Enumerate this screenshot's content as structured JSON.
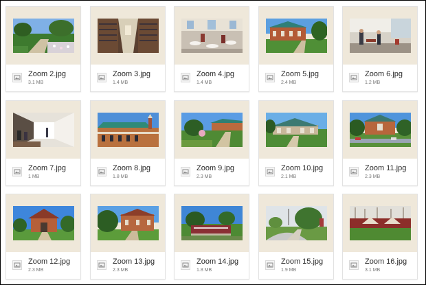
{
  "files": [
    {
      "name": "Zoom 2.jpg",
      "size": "3.1 MB",
      "icon": "image-file-icon"
    },
    {
      "name": "Zoom 3.jpg",
      "size": "1.4 MB",
      "icon": "image-file-icon"
    },
    {
      "name": "Zoom 4.jpg",
      "size": "1.4 MB",
      "icon": "image-file-icon"
    },
    {
      "name": "Zoom 5.jpg",
      "size": "2.4 MB",
      "icon": "image-file-icon"
    },
    {
      "name": "Zoom 6.jpg",
      "size": "1.2 MB",
      "icon": "image-file-icon"
    },
    {
      "name": "Zoom 7.jpg",
      "size": "1 MB",
      "icon": "image-file-icon"
    },
    {
      "name": "Zoom 8.jpg",
      "size": "1.8 MB",
      "icon": "image-file-icon"
    },
    {
      "name": "Zoom 9.jpg",
      "size": "2.3 MB",
      "icon": "image-file-icon"
    },
    {
      "name": "Zoom 10.jpg",
      "size": "2.1 MB",
      "icon": "image-file-icon"
    },
    {
      "name": "Zoom 11.jpg",
      "size": "2.3 MB",
      "icon": "image-file-icon"
    },
    {
      "name": "Zoom 12.jpg",
      "size": "2.3 MB",
      "icon": "image-file-icon"
    },
    {
      "name": "Zoom 13.jpg",
      "size": "2.3 MB",
      "icon": "image-file-icon"
    },
    {
      "name": "Zoom 14.jpg",
      "size": "1.8 MB",
      "icon": "image-file-icon"
    },
    {
      "name": "Zoom 15.jpg",
      "size": "1.9 MB",
      "icon": "image-file-icon"
    },
    {
      "name": "Zoom 16.jpg",
      "size": "3.1 MB",
      "icon": "image-file-icon"
    }
  ],
  "colors": {
    "thumbnail_background": "#efe8da",
    "card_background": "#ffffff",
    "card_border": "#e2e2e2",
    "filename_text": "#2a2a2a",
    "filesize_text": "#777777"
  }
}
